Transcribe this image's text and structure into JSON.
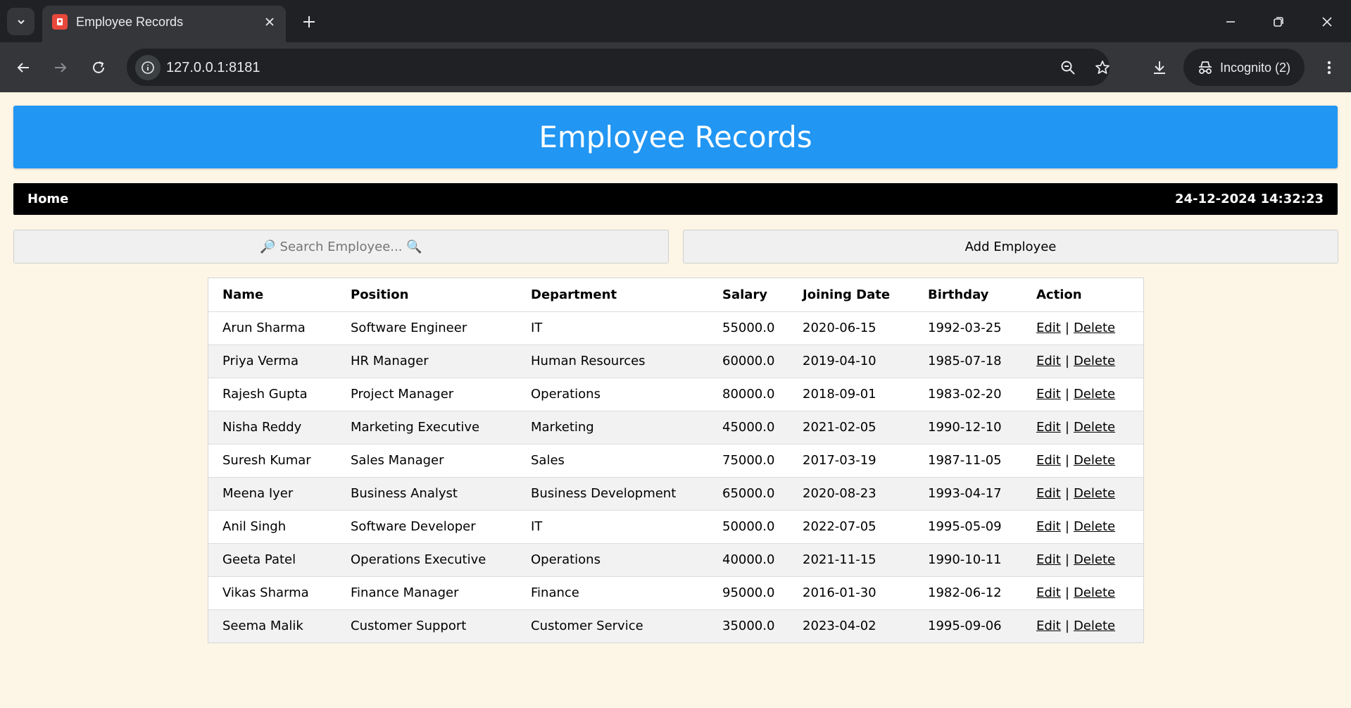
{
  "browser": {
    "tab_title": "Employee Records",
    "url": "127.0.0.1:8181",
    "incognito_label": "Incognito (2)"
  },
  "page": {
    "header_title": "Employee Records",
    "nav_home": "Home",
    "datetime": "24-12-2024 14:32:23",
    "search_placeholder": "🔎 Search Employee... 🔍",
    "add_button": "Add Employee"
  },
  "table": {
    "columns": [
      "Name",
      "Position",
      "Department",
      "Salary",
      "Joining Date",
      "Birthday",
      "Action"
    ],
    "action_edit": "Edit",
    "action_sep": "|",
    "action_delete": "Delete",
    "rows": [
      [
        "Arun Sharma",
        "Software Engineer",
        "IT",
        "55000.0",
        "2020-06-15",
        "1992-03-25"
      ],
      [
        "Priya Verma",
        "HR Manager",
        "Human Resources",
        "60000.0",
        "2019-04-10",
        "1985-07-18"
      ],
      [
        "Rajesh Gupta",
        "Project Manager",
        "Operations",
        "80000.0",
        "2018-09-01",
        "1983-02-20"
      ],
      [
        "Nisha Reddy",
        "Marketing Executive",
        "Marketing",
        "45000.0",
        "2021-02-05",
        "1990-12-10"
      ],
      [
        "Suresh Kumar",
        "Sales Manager",
        "Sales",
        "75000.0",
        "2017-03-19",
        "1987-11-05"
      ],
      [
        "Meena Iyer",
        "Business Analyst",
        "Business Development",
        "65000.0",
        "2020-08-23",
        "1993-04-17"
      ],
      [
        "Anil Singh",
        "Software Developer",
        "IT",
        "50000.0",
        "2022-07-05",
        "1995-05-09"
      ],
      [
        "Geeta Patel",
        "Operations Executive",
        "Operations",
        "40000.0",
        "2021-11-15",
        "1990-10-11"
      ],
      [
        "Vikas Sharma",
        "Finance Manager",
        "Finance",
        "95000.0",
        "2016-01-30",
        "1982-06-12"
      ],
      [
        "Seema Malik",
        "Customer Support",
        "Customer Service",
        "35000.0",
        "2023-04-02",
        "1995-09-06"
      ]
    ]
  },
  "colors": {
    "header_blue": "#2196f3",
    "page_background": "#fdf5e6",
    "navbar": "#000000"
  }
}
